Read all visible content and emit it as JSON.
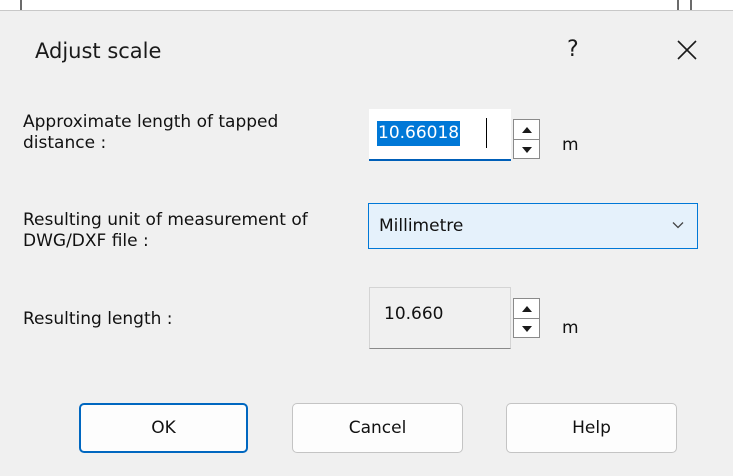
{
  "dialog": {
    "title": "Adjust scale",
    "help_glyph": "?",
    "close_icon": "close-icon"
  },
  "approx": {
    "label": "Approximate length of tapped distance :",
    "value": "10.66018",
    "unit": "m"
  },
  "unit_of_measurement": {
    "label": "Resulting unit of measurement of DWG/DXF file :",
    "selected": "Millimetre"
  },
  "result": {
    "label": "Resulting length :",
    "value": "10.660",
    "unit": "m"
  },
  "buttons": {
    "ok": "OK",
    "cancel": "Cancel",
    "help": "Help"
  },
  "colors": {
    "accent": "#0078d7",
    "dialog_bg": "#f0f0f0",
    "combo_bg": "#e5f1fb"
  }
}
